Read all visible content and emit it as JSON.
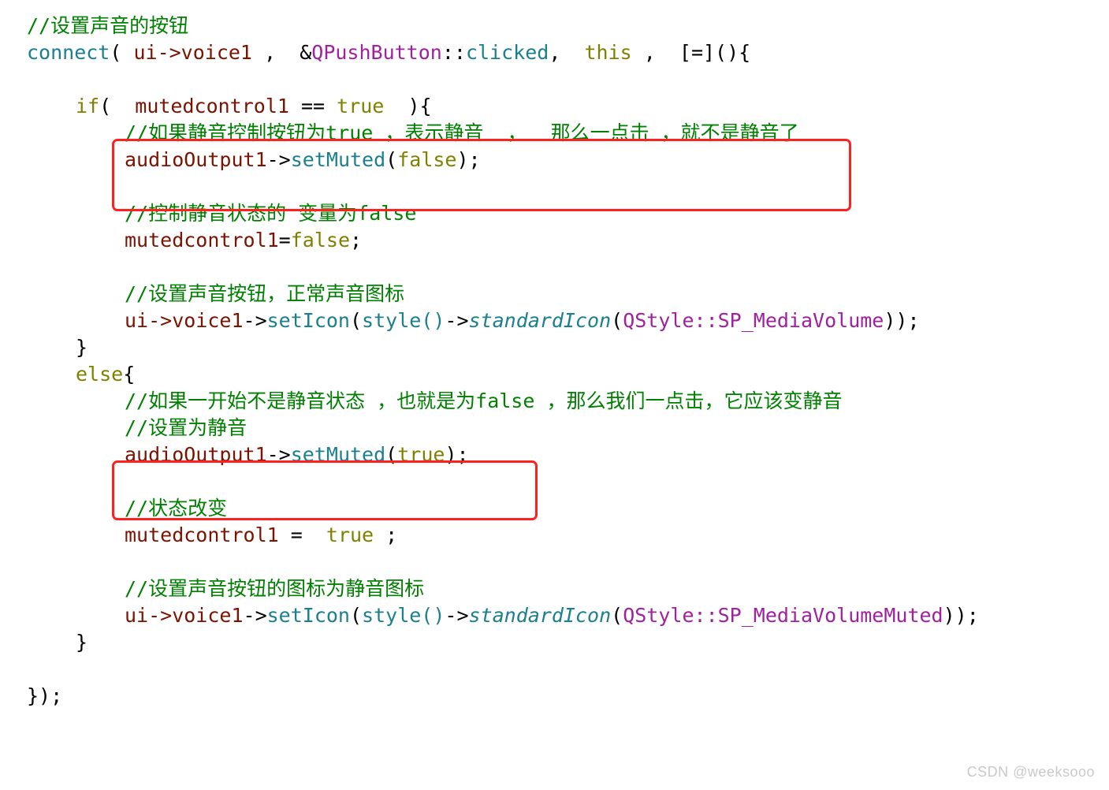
{
  "document": {
    "kind": "code-snippet-screenshot",
    "language": "C++ / Qt",
    "background_color": "#ffffff",
    "highlight_color": "#ff2020"
  },
  "palette": {
    "comment": "#008000",
    "function": "#1a7f8e",
    "variable": "#7c1200",
    "keyword": "#808000",
    "class": "#a020a0",
    "enum": "#a020a0",
    "plain": "#000000",
    "watermark": "#c9c9c9"
  },
  "code": {
    "lines": [
      {
        "id": "l1",
        "indent": 0,
        "text": "//设置声音的按钮"
      },
      {
        "id": "l2",
        "indent": 0,
        "text": "connect( ui->voice1 ,  &QPushButton::clicked,  this ,  [=](){"
      },
      {
        "id": "l3",
        "indent": 0,
        "text": ""
      },
      {
        "id": "l4",
        "indent": 1,
        "text": "if(  mutedcontrol1 == true  ){"
      },
      {
        "id": "l5",
        "indent": 2,
        "text": "//如果静音控制按钮为true ，表示静音  ，  那么一点击 ，就不是静音了"
      },
      {
        "id": "l6",
        "indent": 2,
        "text": "audioOutput1->setMuted(false);"
      },
      {
        "id": "l7",
        "indent": 0,
        "text": ""
      },
      {
        "id": "l8",
        "indent": 2,
        "text": "//控制静音状态的 变量为false"
      },
      {
        "id": "l9",
        "indent": 2,
        "text": "mutedcontrol1=false;"
      },
      {
        "id": "l10",
        "indent": 0,
        "text": ""
      },
      {
        "id": "l11",
        "indent": 2,
        "text": "//设置声音按钮，正常声音图标"
      },
      {
        "id": "l12",
        "indent": 2,
        "text": "ui->voice1->setIcon(style()->standardIcon(QStyle::SP_MediaVolume));"
      },
      {
        "id": "l13",
        "indent": 1,
        "text": "}"
      },
      {
        "id": "l14",
        "indent": 1,
        "text": "else{"
      },
      {
        "id": "l15",
        "indent": 2,
        "text": "//如果一开始不是静音状态 ，也就是为false ，那么我们一点击，它应该变静音"
      },
      {
        "id": "l16",
        "indent": 2,
        "text": "//设置为静音"
      },
      {
        "id": "l17",
        "indent": 2,
        "text": "audioOutput1->setMuted(true);"
      },
      {
        "id": "l18",
        "indent": 0,
        "text": ""
      },
      {
        "id": "l19",
        "indent": 2,
        "text": "//状态改变"
      },
      {
        "id": "l20",
        "indent": 2,
        "text": "mutedcontrol1 =  true ;"
      },
      {
        "id": "l21",
        "indent": 0,
        "text": ""
      },
      {
        "id": "l22",
        "indent": 2,
        "text": "//设置声音按钮的图标为静音图标"
      },
      {
        "id": "l23",
        "indent": 2,
        "text": "ui->voice1->setIcon(style()->standardIcon(QStyle::SP_MediaVolumeMuted));"
      },
      {
        "id": "l24",
        "indent": 1,
        "text": "}"
      },
      {
        "id": "l25",
        "indent": 0,
        "text": ""
      },
      {
        "id": "l26",
        "indent": 0,
        "text": "});"
      }
    ],
    "tokens": {
      "comment_1": "//设置声音的按钮",
      "connect": "connect",
      "paren_open_sp": "( ",
      "ui_voice1": "ui->voice1",
      "comma_1": " ,  ",
      "amp": "&",
      "qpushbutton": "QPushButton",
      "scope": "::",
      "clicked": "clicked",
      "comma_2": ",  ",
      "this": "this",
      "lambda_tail": " ,  [=](){",
      "if_kw": "if",
      "if_open": "(  ",
      "mutedcontrol1": "mutedcontrol1",
      "eq_eq": " == ",
      "true_kw": "true",
      "if_close": "  ){",
      "comment_box1": "//如果静音控制按钮为true ，表示静音  ，  那么一点击 ，就不是静音了",
      "audioOutput1": "audioOutput1",
      "arrow": "->",
      "setMuted": "setMuted",
      "paren_open": "(",
      "false_kw": "false",
      "paren_close_semi": ");",
      "comment_state_false": "//控制静音状态的 变量为false",
      "assign_false": "mutedcontrol1=false;",
      "comment_icon_normal": "//设置声音按钮，正常声音图标",
      "ui_arrow_voice1": "ui->voice1",
      "setIcon": "setIcon",
      "style_call": "style()",
      "standardIcon": "standardIcon",
      "qstyle": "QStyle",
      "sp_mediavolume": "SP_MediaVolume",
      "close_icon_call": "));",
      "brace_close": "}",
      "else_kw": "else",
      "brace_open": "{",
      "comment_else": "//如果一开始不是静音状态 ，也就是为false ，那么我们一点击，它应该变静音",
      "comment_set_muted": "//设置为静音",
      "comment_state_change": "//状态改变",
      "assign_true": "mutedcontrol1 =  true ;",
      "comment_icon_muted": "//设置声音按钮的图标为静音图标",
      "sp_mediavolumemuted": "SP_MediaVolumeMuted",
      "lambda_close": "});"
    }
  },
  "highlights": [
    {
      "id": "box1",
      "label": "highlight-box-unmute",
      "color": "#ff2020"
    },
    {
      "id": "box2",
      "label": "highlight-box-mute",
      "color": "#ff2020"
    }
  ],
  "watermark": {
    "text": "CSDN @weeksooo"
  }
}
